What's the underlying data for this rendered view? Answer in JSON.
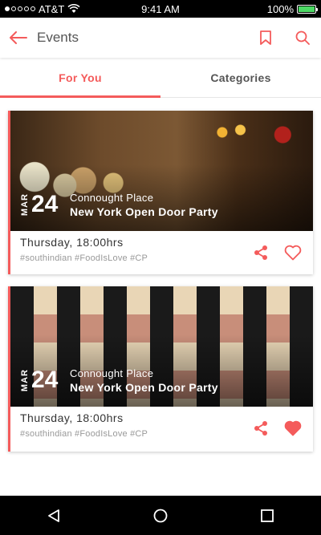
{
  "status_bar": {
    "carrier": "AT&T",
    "time": "9:41 AM",
    "battery_percent": "100%",
    "battery_level": 1.0
  },
  "app_bar": {
    "title": "Events",
    "icons": [
      "back-arrow-icon",
      "bookmark-icon",
      "search-icon"
    ]
  },
  "tabs": [
    {
      "label": "For You",
      "active": true
    },
    {
      "label": "Categories",
      "active": false
    }
  ],
  "events": [
    {
      "month": "MAR",
      "day": "24",
      "location": "Connought Place",
      "name": "New York Open Door Party",
      "time": "Thursday, 18:00hrs",
      "tags": "#southindian #FoodIsLove #CP",
      "liked": false
    },
    {
      "month": "MAR",
      "day": "24",
      "location": "Connought Place",
      "name": "New York Open Door Party",
      "time": "Thursday, 18:00hrs",
      "tags": "#southindian #FoodIsLove #CP",
      "liked": true
    }
  ],
  "colors": {
    "accent": "#f45b5b",
    "status_bar_bg": "#000000",
    "nav_bar_bg": "#000000",
    "battery": "#4cd964"
  }
}
